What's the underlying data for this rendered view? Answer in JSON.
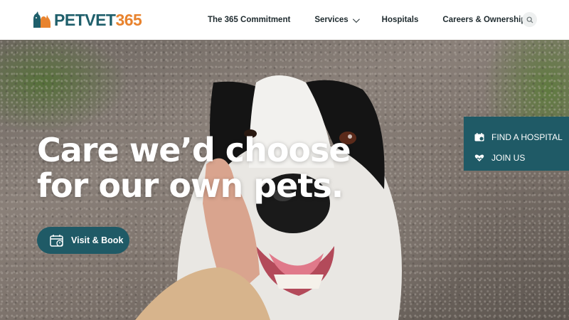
{
  "brand": {
    "name_part1": "PETVET",
    "name_part2": "365",
    "primary_color": "#1f5a66",
    "accent_color": "#e8832e"
  },
  "nav": {
    "items": [
      {
        "label": "The 365 Commitment"
      },
      {
        "label": "Services",
        "has_dropdown": true
      },
      {
        "label": "Hospitals"
      },
      {
        "label": "Careers & Ownership"
      }
    ],
    "search_icon": "search-icon"
  },
  "hero": {
    "headline_line1": "Care we’d choose",
    "headline_line2": "for our own pets.",
    "cta_label": "Visit & Book",
    "cta_icon": "calendar-icon"
  },
  "side_panel": {
    "items": [
      {
        "label": "FIND A HOSPITAL",
        "icon": "hospital-card-icon"
      },
      {
        "label": "JOIN US",
        "icon": "heart-hands-icon"
      }
    ]
  }
}
